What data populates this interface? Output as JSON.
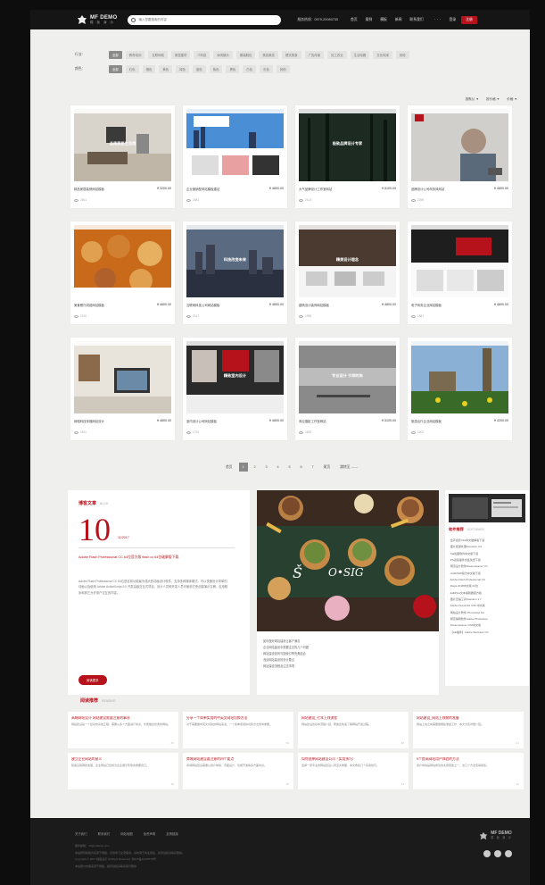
{
  "header": {
    "logo_main": "MF DEMO",
    "logo_sub": "模 板 演 示",
    "search_placeholder": "输入您要搜索的内容",
    "hotline": "服务热线：0579-20083735",
    "nav": [
      "首页",
      "案例",
      "模板",
      "新闻",
      "联系我们"
    ],
    "more": "···",
    "login": "登录",
    "register": "注册"
  },
  "filters": {
    "rows": [
      {
        "label": "行业：",
        "tags": [
          "全部",
          "教育培训",
          "互联网络",
          "家居建材",
          "IT科技",
          "休闲娱乐",
          "服装鞋包",
          "美容美发",
          "餐饮美食",
          "广告传媒",
          "化工农业",
          "生活电器",
          "文化传媒",
          "其他"
        ]
      },
      {
        "label": "颜色：",
        "tags": [
          "全部",
          "红色",
          "橙色",
          "黄色",
          "绿色",
          "蓝色",
          "紫色",
          "黑色",
          "白色",
          "灰色",
          "其他"
        ]
      }
    ],
    "active_index": 0
  },
  "sort": [
    "按默认 ▼",
    "按价格 ▼",
    "价格 ▼"
  ],
  "cards": [
    {
      "title": "精品家居装修网站模板",
      "price": "¥ 3200.00",
      "views": "2561",
      "theme": "living",
      "cap": "品质家居生活馆"
    },
    {
      "title": "企业营销型网站模板建站",
      "price": "¥ 4800.00",
      "views": "2481",
      "theme": "city",
      "cap": ""
    },
    {
      "title": "大气品牌设计工作室网站",
      "price": "¥ 5100.00",
      "views": "2413",
      "theme": "forest",
      "cap": "极致品牌设计专家"
    },
    {
      "title": "品牌设计公司商务风网站",
      "price": "¥ 4800.00",
      "views": "2298",
      "theme": "office",
      "cap": ""
    },
    {
      "title": "美食餐厅烘焙网站模板",
      "price": "¥ 4800.00",
      "views": "2130",
      "theme": "bakery",
      "cap": ""
    },
    {
      "title": "互联网科技公司网站模板",
      "price": "¥ 4800.00",
      "views": "2017",
      "theme": "skyline",
      "cap": "科技改变未来"
    },
    {
      "title": "建筑设计装饰网站模板",
      "price": "¥ 4800.00",
      "views": "1959",
      "theme": "interior",
      "cap": "精美设计理念"
    },
    {
      "title": "电子商务企业网站模板",
      "price": "¥ 4800.00",
      "views": "1881",
      "theme": "ecom",
      "cap": ""
    },
    {
      "title": "网络科技传媒网站设计",
      "price": "¥ 4800.00",
      "views": "1811",
      "theme": "desk",
      "cap": ""
    },
    {
      "title": "室内设计公司网站模板",
      "price": "¥ 4800.00",
      "views": "1734",
      "theme": "kitchen",
      "cap": "精致室内设计"
    },
    {
      "title": "商业摄影工作室网站",
      "price": "¥ 5100.00",
      "views": "1695",
      "theme": "motion",
      "cap": "专业设计 引领时尚"
    },
    {
      "title": "旅游出行企业网站模板",
      "price": "¥ 4200.00",
      "views": "1602",
      "theme": "london",
      "cap": ""
    }
  ],
  "pagination": {
    "prev": "首页",
    "pages": [
      "1",
      "2",
      "3",
      "4",
      "5",
      "6",
      "7"
    ],
    "current": "1",
    "next": "尾页",
    "jump": "跳转至 ------"
  },
  "blog": {
    "zh": "博客文章",
    "en": "BLOG",
    "day": "10",
    "month": "11/2017",
    "title": "Adobe Flash Professional CC 64位官方版 flash cc 64位破解版下载",
    "body": "Adobe Flash Professional CC 64位是目前功能最为强大的动画设计软件，支持多种媒体格式，可以快速设计简单的动画以及使用 Adobe ActionScript 3.0 开发高级交互式项目。设计人员和开发人员可使用它来创建演示文稿、应用程序和其它允许用户交互的内容。",
    "button": "阅读更多"
  },
  "food_list": [
    "· 如何做好网站建设让客户满意",
    "· 企业网站建设中需要注意的几个问题",
    "· 网站建设如何与搜索引擎完美结合",
    "· 浅谈网站建设的设计要点",
    "· 网站建设流程及注意事项"
  ],
  "software": {
    "zh": "软件推荐",
    "en": "SOFTWARE",
    "items": [
      "· 会声会影X10中文破解版下载",
      "· 图片批量处理Fotosizer 2.0",
      "· Sai绘图软件中文版下载",
      "· PS滤镜插件合集免费下载",
      "· 网页设计软件Dreamweaver CC",
      "· CAD2018官方中文版下载",
      "· Adobe Flash Professional CC",
      "· Maya 2018中文版 64位",
      "· EditPlus文本编辑器官方版",
      "· 图片压缩工具Caesium 1.7",
      "· Adobe Fireworks CS6 中文版",
      "· 网站设计软件 Photoshop CC",
      "· 网页编辑软件Adobe Photoshop",
      "· Dreamweaver CS6中文版",
      "· 【AE插件】Adobe Illustrator CC"
    ]
  },
  "reading": {
    "zh": "阅读推荐",
    "en": "READING",
    "items": [
      {
        "title": "高端网站设计 网站建设需要注意的事项",
        "body": "网站建设是一个复杂的系统工程，需要从多个方面进行考虑，才能做出优秀的网站。",
        "meta": "63"
      },
      {
        "title": "分享一个简单实用的中英文网站切换方法",
        "body": "对于需要做中英文切换的网站来说，一个简单易用的切换方法非常重要。",
        "meta": "54"
      },
      {
        "title": "网站建设_七年上线流程",
        "body": "网站建设的基本流程介绍，帮助您快速了解网站开发过程。",
        "meta": "48"
      },
      {
        "title": "网站建设_网站上线前的准备",
        "body": "网站上线之前需要做哪些准备工作，本文为您详细介绍。",
        "meta": "41"
      },
      {
        "title": "建立企业网站的意义",
        "body": "随着互联网的发展，企业网站已经成为企业展示形象的重要窗口。",
        "meta": "39"
      },
      {
        "title": "商城网站建设要注意的四个要点",
        "body": "商城网站建设需要从用户体验、页面设计、功能开发等多方面考虑。",
        "meta": "36"
      },
      {
        "title": "如何选择网站建设公司（实用技巧）",
        "body": "选择一家专业的网站建设公司至关重要，本文教您几个实用技巧。",
        "meta": "33"
      },
      {
        "title": "5个提高网站用户体验的方法",
        "body": "用户体验是网站成功的关键因素之一，这几个方法值得借鉴。",
        "meta": "30"
      }
    ]
  },
  "footer": {
    "links": [
      "关于我们",
      "联系我们",
      "网站地图",
      "免责声明",
      "友情链接"
    ],
    "lines": [
      "服务邮箱：mf@mfdemo.com",
      "本站所有模板均来源于网络，仅供学习交流使用，请勿用于商业用途，如有侵权请联系删除。",
      "Copyright © 2017 模板演示 All Right Reserved. 浙ICP备12345678号",
      "本站部分内容来源于网络，如有侵权请联系我们删除"
    ],
    "logo_main": "MF DEMO",
    "logo_sub": "模 板 演 示"
  },
  "colors": {
    "accent": "#b5121b",
    "header_bg": "#151515",
    "page_bg": "#efefed",
    "footer_bg": "#1b1b1b"
  }
}
